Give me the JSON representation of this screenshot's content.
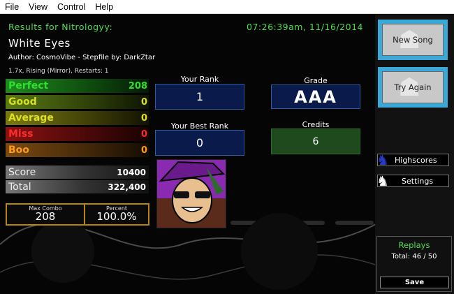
{
  "menu": [
    "File",
    "View",
    "Control",
    "Help"
  ],
  "header": {
    "results_for": "Results for Nitrologyy:",
    "datetime": "07:26:39am, 11/16/2014",
    "song_title": "White Eyes",
    "author_line": "Author: CosmoVibe  -  Stepfile by: DarkZtar",
    "mods_line": "1.7x, Rising (Mirror), Restarts: 1"
  },
  "judgements": [
    {
      "label": "Perfect",
      "count": "208",
      "color": "#1c7a1c",
      "text": "#2de02d"
    },
    {
      "label": "Good",
      "count": "0",
      "color": "#4f6a14",
      "text": "#d8e020"
    },
    {
      "label": "Average",
      "count": "0",
      "color": "#6a6a10",
      "text": "#e0e020"
    },
    {
      "label": "Miss",
      "count": "0",
      "color": "#7a1010",
      "text": "#ff2a2a"
    },
    {
      "label": "Boo",
      "count": "0",
      "color": "#6a4010",
      "text": "#ff9a1a"
    }
  ],
  "score": {
    "label": "Score",
    "value": "10400"
  },
  "total": {
    "label": "Total",
    "value": "322,400"
  },
  "max_combo": {
    "label": "Max Combo",
    "value": "208"
  },
  "percent": {
    "label": "Percent",
    "value": "100.0%"
  },
  "your_rank": {
    "label": "Your Rank",
    "value": "1"
  },
  "best_rank": {
    "label": "Your Best Rank",
    "value": "0"
  },
  "grade": {
    "label": "Grade",
    "value": "AAA"
  },
  "credits": {
    "label": "Credits",
    "value": "6"
  },
  "buttons": {
    "new_song": "New Song",
    "try_again": "Try Again",
    "highscores": "Highscores",
    "settings": "Settings",
    "save": "Save"
  },
  "replays": {
    "label": "Replays",
    "total": "Total: 46 / 50"
  },
  "icons": {
    "highscores": "person-icon",
    "settings": "person-icon",
    "new_song": "silhouette-icon",
    "try_again": "silhouette-icon"
  }
}
